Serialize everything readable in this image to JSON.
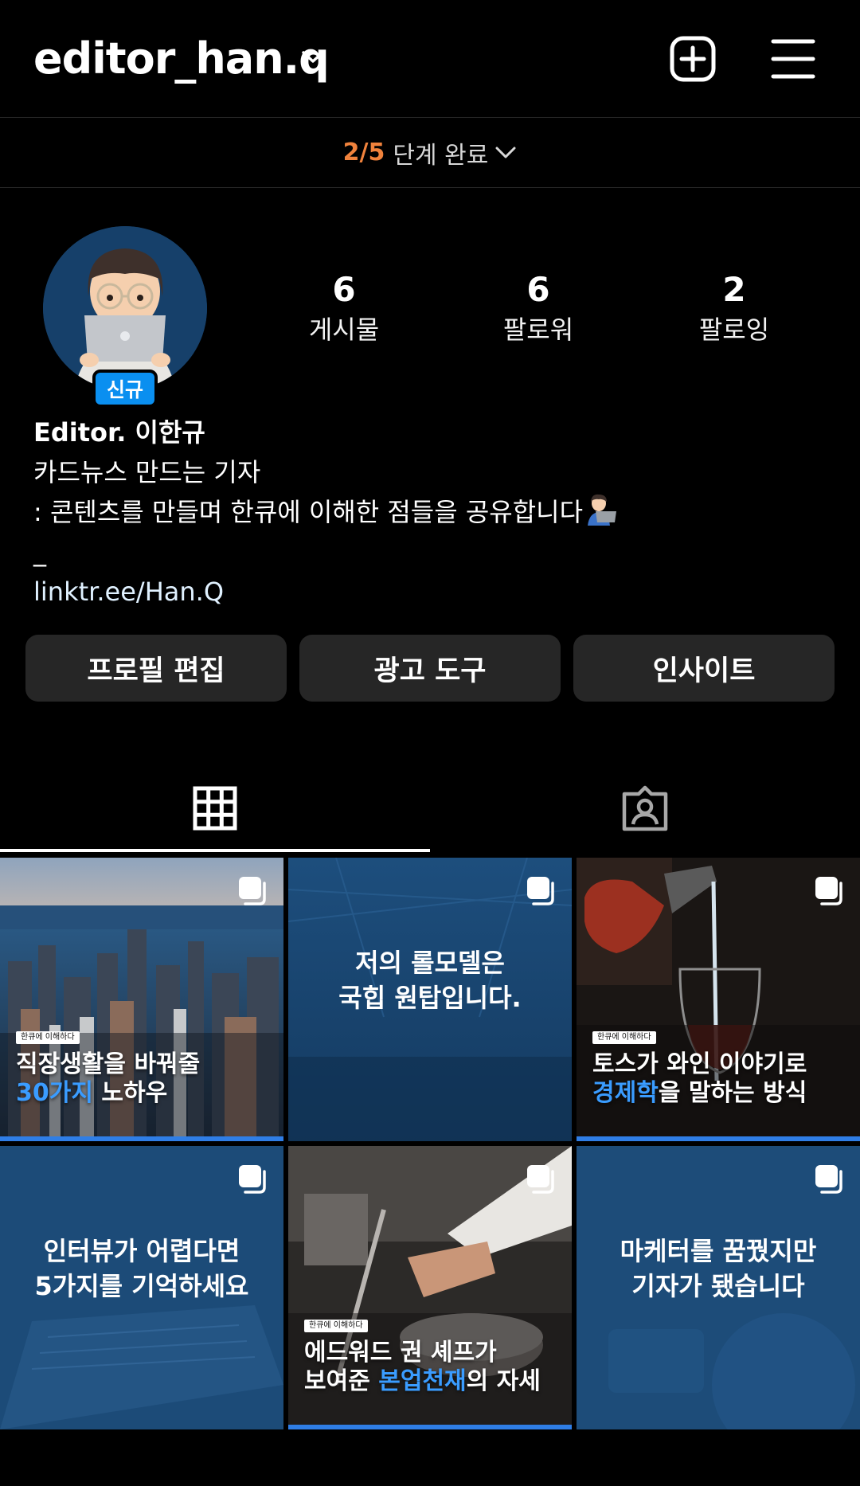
{
  "header": {
    "username": "editor_han.q"
  },
  "steps": {
    "progress": "2/5",
    "label": "단계 완료"
  },
  "profile": {
    "new_badge": "신규",
    "stats": [
      {
        "value": "6",
        "label": "게시물"
      },
      {
        "value": "6",
        "label": "팔로워"
      },
      {
        "value": "2",
        "label": "팔로잉"
      }
    ],
    "bio": {
      "name": "Editor. 이한규",
      "line1": "카드뉴스 만드는 기자",
      "line2": ": 콘텐츠를 만들며 한큐에 이해한 점들을 공유합니다",
      "line3": "_",
      "link": "linktr.ee/Han.Q"
    }
  },
  "buttons": {
    "edit_profile": "프로필 편집",
    "ad_tools": "광고 도구",
    "insights": "인사이트"
  },
  "tabs": [
    {
      "icon": "grid-icon",
      "active": true
    },
    {
      "icon": "tagged-person-icon",
      "active": false
    }
  ],
  "posts": [
    {
      "tag": "한큐에 이해하다",
      "line1": "직장생활을 바꿔줄",
      "line2_blue": "30가지",
      "line2_rest": " 노하우"
    },
    {
      "title1": "저의 롤모델은",
      "title2": "국힙 원탑입니다."
    },
    {
      "tag": "한큐에 이해하다",
      "line1": "토스가 와인 이야기로",
      "line2_blue": "경제학",
      "line2_rest": "을 말하는 방식"
    },
    {
      "title1": "인터뷰가 어렵다면",
      "title2": "5가지를 기억하세요"
    },
    {
      "tag": "한큐에 이해하다",
      "line1": "에드워드 권 셰프가",
      "line2_pre": "보여준 ",
      "line2_blue": "본업천재",
      "line2_rest": "의 자세"
    },
    {
      "title1": "마케터를 꿈꿨지만",
      "title2": "기자가 됐습니다"
    }
  ],
  "colors": {
    "background": "#000000",
    "button_bg": "#262626",
    "progress_orange": "#f0823c",
    "badge_blue": "#0a8ff0",
    "accent_blue": "#2f7ee6"
  }
}
